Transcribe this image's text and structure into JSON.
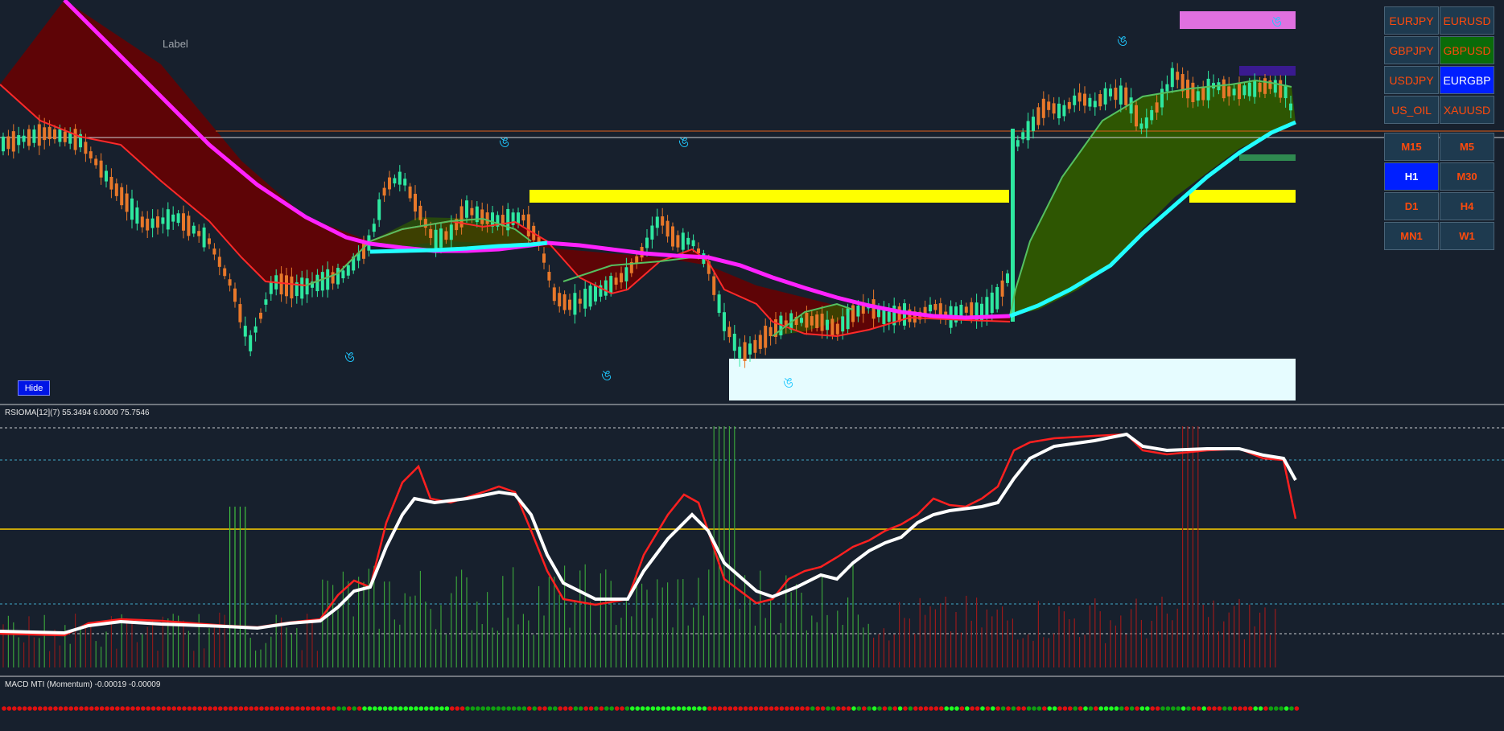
{
  "main": {
    "label_text": "Label",
    "hide_button": "Hide",
    "signal_glyph": "ঙ"
  },
  "indicators": {
    "rsioma_title": "RSIOMA[12](7) 55.3494 6.0000 75.7546",
    "macd_title": "MACD MTI (Momentum) -0.00019 -0.00009"
  },
  "symbols": [
    "EURJPY",
    "EURUSD",
    "GBPJPY",
    "GBPUSD",
    "USDJPY",
    "EURGBP",
    "US_OIL",
    "XAUUSD"
  ],
  "timeframes": [
    "M15",
    "M5",
    "H1",
    "M30",
    "D1",
    "H4",
    "MN1",
    "W1"
  ],
  "active": {
    "symbol_green": "GBPUSD",
    "symbol_blue": "EURGBP",
    "timeframe": "H1"
  },
  "colors": {
    "background": "#17202d",
    "bull_candle": "#2ee8a0",
    "bear_candle": "#e8782a",
    "magenta_ma": "#ff22ff",
    "cyan_ma": "#22ffff",
    "red_ma": "#ff2a2a",
    "green_ma": "#55c060",
    "bear_fill": "#6b0000",
    "bull_fill": "#2f5a00",
    "yellow_zone": "#ffff00",
    "light_zone": "#e6fcff",
    "pink_zone": "#e070e0"
  }
}
